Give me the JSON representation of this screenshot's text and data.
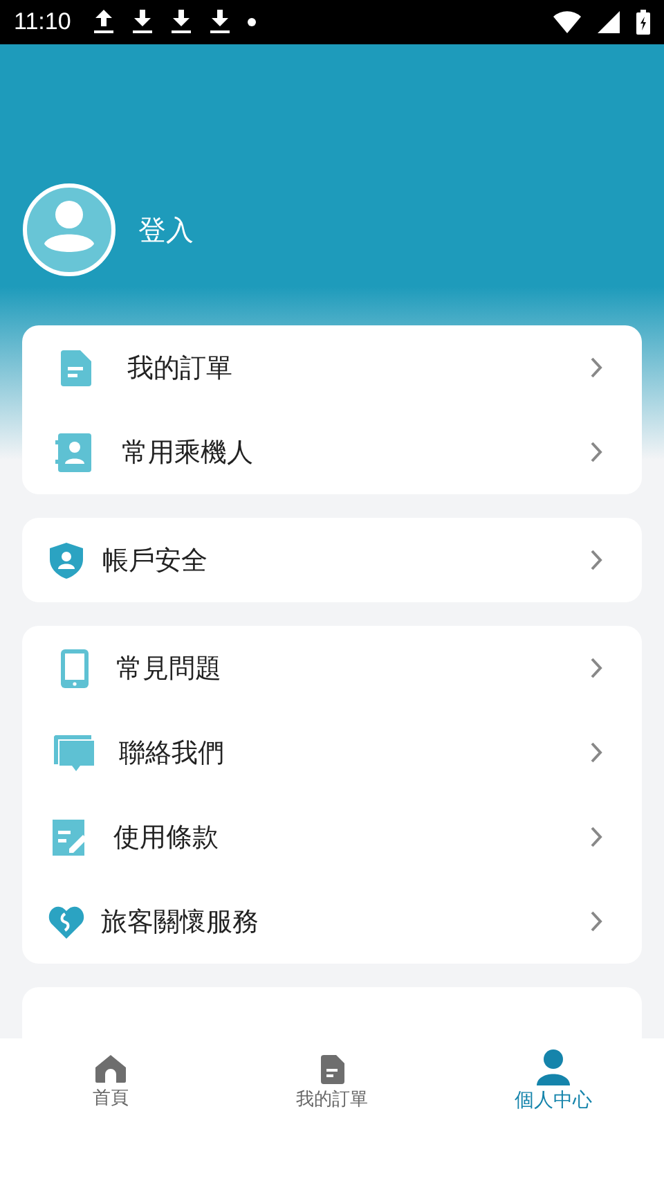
{
  "status_bar": {
    "time": "11:10"
  },
  "profile": {
    "login_label": "登入"
  },
  "groups": [
    {
      "items": [
        {
          "kind": "document",
          "label": "我的訂單"
        },
        {
          "kind": "contact",
          "label": "常用乘機人"
        }
      ]
    },
    {
      "items": [
        {
          "kind": "shield",
          "label": "帳戶安全"
        }
      ]
    },
    {
      "items": [
        {
          "kind": "phone",
          "label": "常見問題"
        },
        {
          "kind": "chat",
          "label": "聯絡我們"
        },
        {
          "kind": "edit",
          "label": "使用條款"
        },
        {
          "kind": "heart",
          "label": "旅客關懷服務"
        }
      ]
    }
  ],
  "tabs": [
    {
      "kind": "home",
      "label": "首頁",
      "selected": false
    },
    {
      "kind": "document",
      "label": "我的訂單",
      "selected": false
    },
    {
      "kind": "person",
      "label": "個人中心",
      "selected": true
    }
  ]
}
